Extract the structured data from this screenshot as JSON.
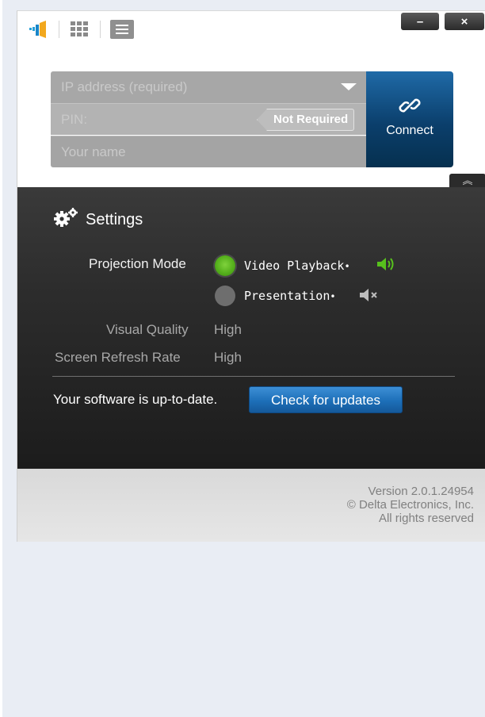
{
  "titlebar": {
    "icons": [
      "app-logo-icon",
      "grid-icon",
      "list-icon"
    ],
    "minimize_label": "–",
    "close_label": "×"
  },
  "connect_form": {
    "ip_placeholder": "IP address (required)",
    "pin_placeholder": "PIN:",
    "pin_badge": "Not Required",
    "name_placeholder": "Your name",
    "connect_label": "Connect"
  },
  "settings": {
    "title": "Settings",
    "projection_mode_label": "Projection Mode",
    "projection_options": [
      {
        "label": "Video Playback",
        "selected": true,
        "icon": "speaker-on-icon"
      },
      {
        "label": "Presentation",
        "selected": false,
        "icon": "speaker-muted-icon"
      }
    ],
    "visual_quality_label": "Visual Quality",
    "visual_quality_value": "High",
    "refresh_rate_label": "Screen Refresh Rate",
    "refresh_rate_value": "High",
    "update_status": "Your software is up-to-date.",
    "check_updates_label": "Check for updates"
  },
  "footer": {
    "version": "Version 2.0.1.24954",
    "copyright": "© Delta Electronics, Inc.",
    "rights": "All rights reserved"
  },
  "colors": {
    "accent_blue": "#1d6fb8",
    "connect_bg": "#0b3f6c",
    "selected_green": "#55b01c",
    "panel_dark": "#2d2d2d"
  }
}
